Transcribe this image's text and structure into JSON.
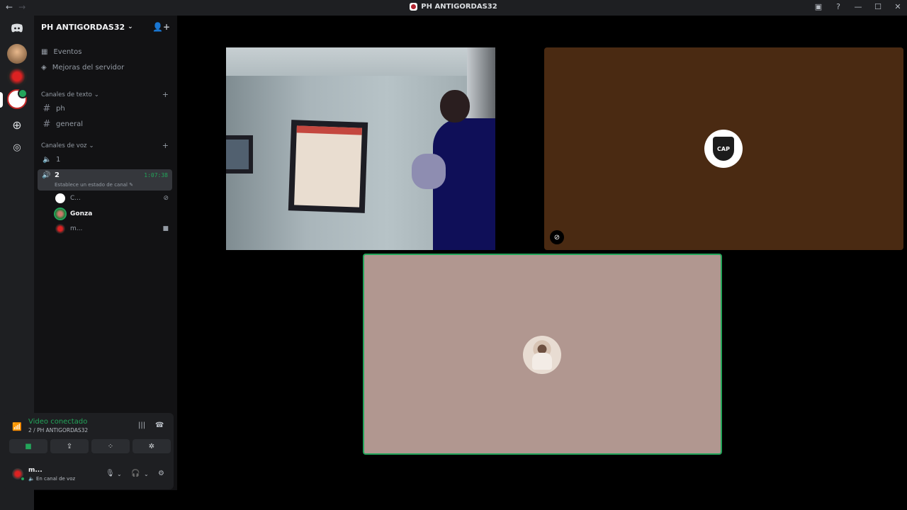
{
  "window": {
    "title": "PH ANTIGORDAS32"
  },
  "server": {
    "name": "PH ANTIGORDAS32"
  },
  "menu": [
    {
      "label": "Eventos",
      "icon": "calendar-icon"
    },
    {
      "label": "Mejoras del servidor",
      "icon": "boost-icon"
    }
  ],
  "text_category": {
    "label": "Canales de texto",
    "channels": [
      "ph",
      "general"
    ]
  },
  "voice_category": {
    "label": "Canales de voz",
    "channels": [
      {
        "name": "1"
      },
      {
        "name": "2",
        "timer": "1:07:38",
        "status": "Establece un estado de canal",
        "users": [
          {
            "name": "C...",
            "icon": "mic-muted-icon"
          },
          {
            "name": "Gonza"
          },
          {
            "name": "m...",
            "icon": "video-icon"
          }
        ]
      }
    ]
  },
  "voice_panel": {
    "title": "Video conectado",
    "subtitle": "2 / PH ANTIGORDAS32",
    "user": {
      "name": "m...",
      "status": "En canal de voz"
    }
  },
  "stage": {
    "tiles": [
      {
        "kind": "camera"
      },
      {
        "kind": "avatar",
        "label": "CAP",
        "muted": true
      },
      {
        "kind": "avatar",
        "speaking": true
      }
    ]
  },
  "colors": {
    "accent_green": "#23a55a",
    "sidebar_bg": "#121214",
    "tile_brown": "#4a2a12",
    "tile_pink": "#b19790"
  }
}
